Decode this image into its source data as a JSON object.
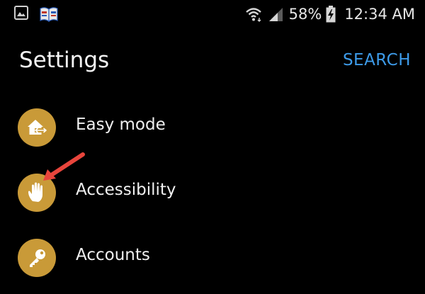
{
  "status_bar": {
    "battery_percent": "58%",
    "time": "12:34 AM",
    "icons": [
      "gallery-icon",
      "book-icon",
      "wifi-icon",
      "signal-icon",
      "battery-charging-icon"
    ]
  },
  "header": {
    "title": "Settings",
    "search_label": "SEARCH"
  },
  "settings": {
    "items": [
      {
        "label": "Easy mode",
        "icon": "home-resize-icon"
      },
      {
        "label": "Accessibility",
        "icon": "hand-icon"
      },
      {
        "label": "Accounts",
        "icon": "key-icon"
      }
    ]
  },
  "colors": {
    "background": "#000000",
    "accent": "#c99a38",
    "search": "#3d9be9",
    "arrow": "#e8453c"
  }
}
